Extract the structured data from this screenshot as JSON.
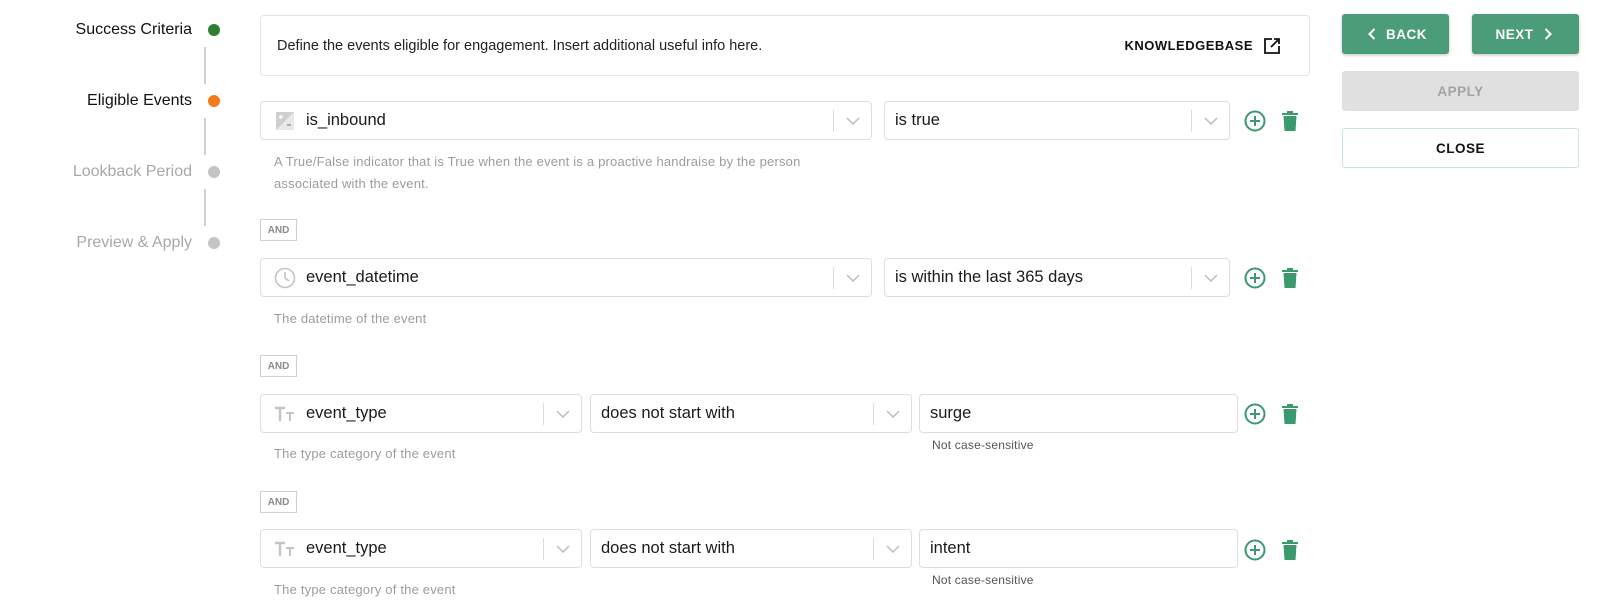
{
  "stepper": {
    "steps": [
      {
        "label": "Success Criteria",
        "state": "complete",
        "color": "#2e7d32"
      },
      {
        "label": "Eligible Events",
        "state": "current",
        "color": "#f07c1b"
      },
      {
        "label": "Lookback Period",
        "state": "pending",
        "color": "#c4c4c4"
      },
      {
        "label": "Preview & Apply",
        "state": "pending",
        "color": "#c4c4c4"
      }
    ]
  },
  "info": {
    "text": "Define the events eligible for engagement. Insert additional useful info here.",
    "link_label": "KNOWLEDGEBASE",
    "link_icon": "external-link-icon"
  },
  "conditions": [
    {
      "field": "is_inbound",
      "field_icon": "boolean-icon",
      "operator": "is true",
      "description": "A True/False indicator that is True when the event is a proactive handraise by the person associated with the event.",
      "description_lines": [
        "A True/False indicator that is True when the event is a proactive handraise by the person",
        "associated with the event."
      ]
    },
    {
      "connector": "AND",
      "field": "event_datetime",
      "field_icon": "clock-icon",
      "operator": "is within the last 365 days",
      "description": "The datetime of the event"
    },
    {
      "connector": "AND",
      "field": "event_type",
      "field_icon": "text-type-icon",
      "operator": "does not start with",
      "value": "surge",
      "value_hint": "Not case-sensitive",
      "description": "The type category of the event"
    },
    {
      "connector": "AND",
      "field": "event_type",
      "field_icon": "text-type-icon",
      "operator": "does not start with",
      "value": "intent",
      "value_hint": "Not case-sensitive",
      "description": "The type category of the event"
    }
  ],
  "actions": {
    "back_label": "BACK",
    "next_label": "NEXT",
    "apply_label": "APPLY",
    "close_label": "CLOSE"
  },
  "colors": {
    "accent": "#4a9d78",
    "disabled": "#e0e0e0"
  }
}
